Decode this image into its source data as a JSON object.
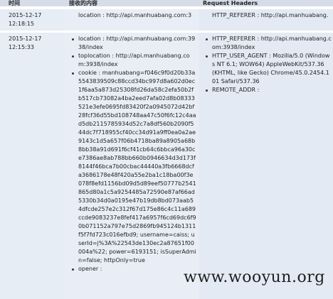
{
  "header": {
    "time": "时间",
    "body": "接收的内容",
    "request_headers": "Request Headers"
  },
  "rows": [
    {
      "time": "2015-12-17\n12:18:15",
      "body": [
        "location : http://api.manhuabang.com:3"
      ],
      "headers": [
        "HTTP_REFERER : http://api.manhuabang."
      ]
    },
    {
      "time": "2015-12-17\n12:15:33",
      "body": [
        "location : http://api.manhuabang.com:3938/index",
        "toplocation : http://api.manhuabang.com:3938/index",
        "cookie : manhuabang=f046c9f0d20b33a5543839509c88ccd34bc997d8a602d0ec1f6aa5a873d25308fd26da58c2efa50b2fb517cb73082a4ba2eed7afa02d8b08333521e3efe0695fd83420f2a0945072d42bf28fcf36d55bd108748aa47c50f6fc12c4aad5db2115785934d52c7a8df560b2090f544dc7f718955cf40cc34d91a9ff0ea0a2ae9143c1d5a657f06b4718ba89a8905a68b8bb38a91d691f6cf41cb64c6bbca96a30ce7386ae8ab788bb660b0946634d3d173f8144f46bca7b00cbac44440a3fb6668dcfa3686178e48f420a55e2ba1c18ba00f3e078f8efd1156bd09d5d89eef50777b2541865d80a1c5a9254485a72590e87af66ad5330b34d0a0195e47b19db8bd073aab54dfcde257e2c312f67d175e86c4c11a689ccde9083237e8fef417a6957f6cd69dc6f90b071152a797e75d2869fb945124b1311f5f7fd723c016efbd9; username=caiss; userId=j%3A%22543de130ec2a87651f00004a%22; power=6193151; isSuperAdmin=false; httpOnly=true",
        "opener :"
      ],
      "headers": [
        "HTTP_REFERER : http://api.manhuabang.com:3938/index",
        "HTTP_USER_AGENT : Mozilla/5.0 (Windows NT 6.1; WOW64) AppleWebKit/537.36 (KHTML, like Gecko) Chrome/45.0.2454.101 Safari/537.36",
        "REMOTE_ADDR :"
      ]
    }
  ],
  "watermark": "www.wooyun.org"
}
